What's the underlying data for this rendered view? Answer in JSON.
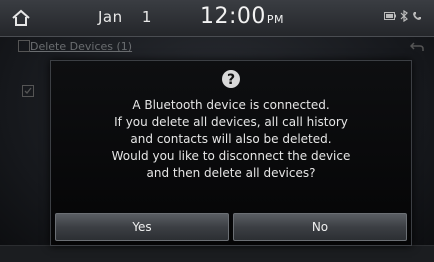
{
  "status_bar": {
    "date_month": "Jan",
    "date_day": "1",
    "time": "12:00",
    "ampm": "PM"
  },
  "background": {
    "title": "Delete Devices (1)"
  },
  "dialog": {
    "icon": "question-icon",
    "message_lines": [
      "A Bluetooth device is connected.",
      "If you delete all devices, all call history",
      "and contacts will also be deleted.",
      "Would you like to disconnect the device",
      "and then delete all devices?"
    ],
    "yes_label": "Yes",
    "no_label": "No"
  }
}
